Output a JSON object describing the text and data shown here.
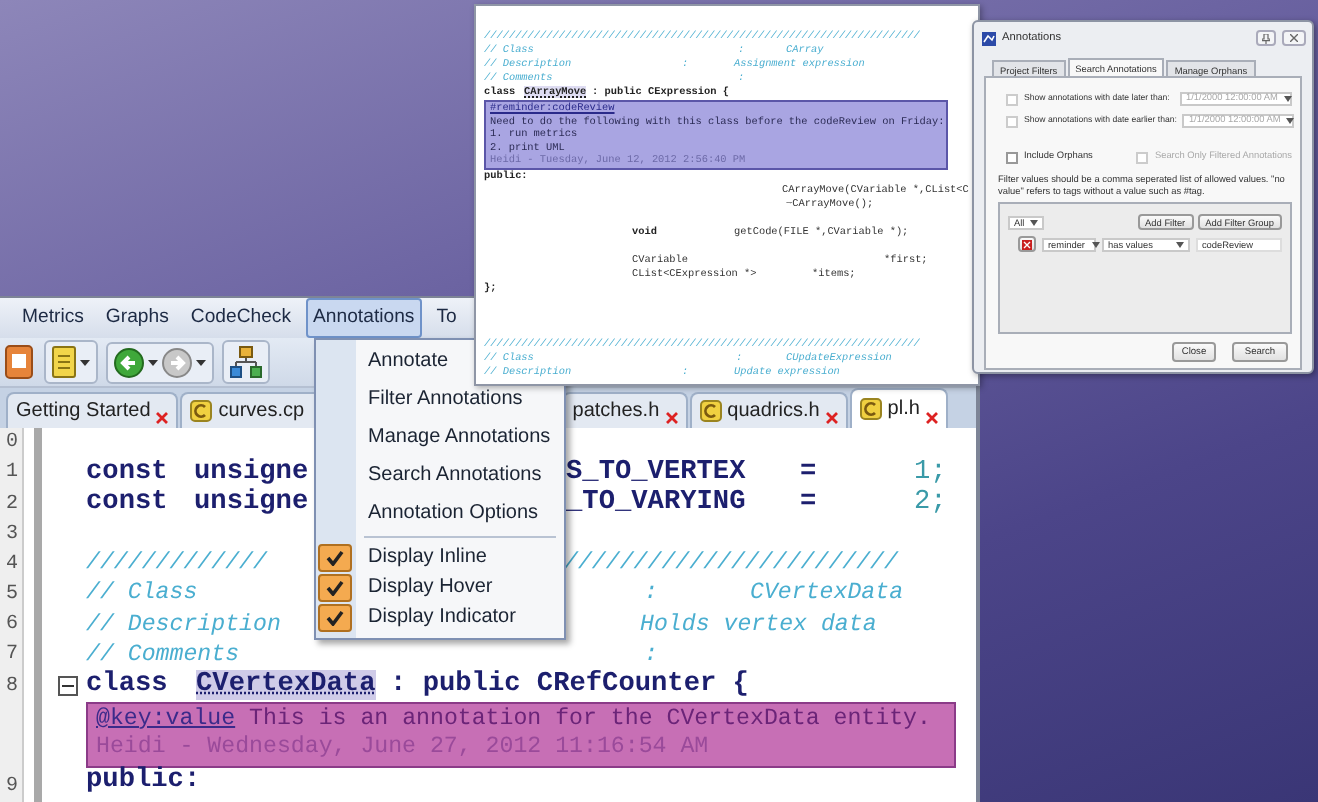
{
  "code_window": {
    "lines": [
      {
        "kind": "code",
        "segments": [
          {
            "text": "//////////////////////////////////////////////////////////////////////",
            "kind": "comment"
          }
        ]
      },
      {
        "kind": "code",
        "segments": [
          {
            "text": "// Class",
            "kind": "comment"
          },
          {
            "text": ":",
            "kind": "comment"
          },
          {
            "text": "CArray",
            "kind": "comment"
          }
        ]
      },
      {
        "kind": "code",
        "segments": [
          {
            "text": "// Description",
            "kind": "comment"
          },
          {
            "text": ":",
            "kind": "comment"
          },
          {
            "text": "Assignment expression",
            "kind": "comment"
          }
        ]
      },
      {
        "kind": "code",
        "segments": [
          {
            "text": "// Comments",
            "kind": "comment"
          },
          {
            "text": ":",
            "kind": "comment"
          }
        ]
      },
      {
        "kind": "code",
        "segments": [
          {
            "text": "class",
            "kind": "keyword"
          },
          {
            "text": "CArrayMove",
            "kind": "highlight"
          },
          {
            "text": ": public CExpression {",
            "kind": "keyword"
          }
        ]
      },
      {
        "kind": "annotation",
        "tag": "#reminder:codeReview",
        "body": [
          "Need to do the following with this class before the codeReview on Friday:",
          "1. run metrics",
          "2. print UML"
        ],
        "author": "Heidi - Tuesday, June 12, 2012 2:56:40 PM"
      },
      {
        "kind": "code",
        "segments": [
          {
            "text": "public:",
            "kind": "keyword"
          }
        ]
      },
      {
        "kind": "code",
        "segments": [
          {
            "text": "CArrayMove(CVariable *,CList<C",
            "kind": "plain"
          }
        ]
      },
      {
        "kind": "code",
        "segments": [
          {
            "text": "~CArrayMove();",
            "kind": "plain"
          }
        ]
      },
      {
        "kind": "blank"
      },
      {
        "kind": "code",
        "segments": [
          {
            "text": "void",
            "kind": "keyword"
          },
          {
            "text": "getCode(FILE *,CVariable *);",
            "kind": "plain"
          }
        ]
      },
      {
        "kind": "blank"
      },
      {
        "kind": "code",
        "segments": [
          {
            "text": "CVariable",
            "kind": "plain"
          },
          {
            "text": "*first;",
            "kind": "plain"
          }
        ]
      },
      {
        "kind": "code",
        "segments": [
          {
            "text": "CList<CExpression *>",
            "kind": "plain"
          },
          {
            "text": "*items;",
            "kind": "plain"
          }
        ]
      },
      {
        "kind": "code",
        "segments": [
          {
            "text": "};",
            "kind": "keyword"
          }
        ]
      },
      {
        "kind": "blank"
      },
      {
        "kind": "blank"
      },
      {
        "kind": "blank"
      },
      {
        "kind": "code",
        "segments": [
          {
            "text": "//////////////////////////////////////////////////////////////////////",
            "kind": "comment"
          }
        ]
      },
      {
        "kind": "code",
        "segments": [
          {
            "text": "// Class",
            "kind": "comment"
          },
          {
            "text": ":",
            "kind": "comment"
          },
          {
            "text": "CUpdateExpression",
            "kind": "comment"
          }
        ]
      },
      {
        "kind": "code",
        "segments": [
          {
            "text": "// Description",
            "kind": "comment"
          },
          {
            "text": ":",
            "kind": "comment"
          },
          {
            "text": "Update expression",
            "kind": "comment"
          }
        ]
      }
    ]
  },
  "annotations_dialog": {
    "title": "Annotations",
    "tabs": [
      {
        "label": "Project Filters",
        "selected": false
      },
      {
        "label": "Search Annotations",
        "selected": true
      },
      {
        "label": "Manage Orphans",
        "selected": false
      }
    ],
    "date_filters": [
      {
        "label": "Show annotations with date later than:",
        "checked": false,
        "value": "1/1/2000 12:00:00 AM",
        "disabled": true
      },
      {
        "label": "Show annotations with date earlier than:",
        "checked": false,
        "value": "1/1/2000 12:00:00 AM",
        "disabled": true
      }
    ],
    "include_orphans": {
      "label": "Include Orphans",
      "checked": false
    },
    "search_only_filtered": {
      "label": "Search Only Filtered Annotations",
      "checked": false,
      "disabled": true
    },
    "help_text": "Filter values should be a comma seperated list of allowed values. \"no value\" refers to tags without a value such as #tag.",
    "match": "All",
    "add_filter": "Add Filter",
    "add_filter_group": "Add Filter Group",
    "filters": [
      {
        "tag": "reminder",
        "condition": "has values",
        "value": "codeReview"
      }
    ],
    "buttons": [
      "Close",
      "Search"
    ]
  },
  "main_window": {
    "menubar": [
      {
        "label": "Metrics",
        "selected": false
      },
      {
        "label": "Graphs",
        "selected": false
      },
      {
        "label": "CodeCheck",
        "selected": false
      },
      {
        "label": "Annotations",
        "selected": true
      },
      {
        "label": "To",
        "selected": false
      }
    ],
    "tabs": [
      {
        "label": "Getting Started",
        "selected": false,
        "file_icon": false,
        "closable": true
      },
      {
        "label": "curves.cp",
        "selected": false,
        "file_icon": true,
        "closable": false
      },
      {
        "label": "patches.h",
        "selected": false,
        "file_icon": false,
        "closable": true
      },
      {
        "label": "quadrics.h",
        "selected": false,
        "file_icon": true,
        "closable": true
      },
      {
        "label": "pl.h",
        "selected": true,
        "file_icon": true,
        "closable": true
      }
    ],
    "lines": [
      {
        "kind": "code",
        "number": "0"
      },
      {
        "kind": "code",
        "number": "1",
        "segments": [
          {
            "text": "const",
            "kind": "keyword"
          },
          {
            "text": "unsigne",
            "kind": "keyword"
          },
          {
            "text": "S_TO_VERTEX",
            "kind": "keyword"
          },
          {
            "text": "=",
            "kind": "keyword"
          },
          {
            "text": "1;",
            "kind": "number"
          }
        ]
      },
      {
        "kind": "code",
        "number": "2",
        "segments": [
          {
            "text": "const",
            "kind": "keyword"
          },
          {
            "text": "unsigne",
            "kind": "keyword"
          },
          {
            "text": "_TO_VARYING",
            "kind": "keyword"
          },
          {
            "text": "=",
            "kind": "keyword"
          },
          {
            "text": "2;",
            "kind": "number"
          }
        ]
      },
      {
        "kind": "code",
        "number": "3"
      },
      {
        "kind": "code",
        "number": "4",
        "segments": [
          {
            "text": "/////////////",
            "kind": "comment"
          },
          {
            "text": "////////////////////////",
            "kind": "comment"
          }
        ]
      },
      {
        "kind": "code",
        "number": "5",
        "segments": [
          {
            "text": "// Class",
            "kind": "comment"
          },
          {
            "text": ":",
            "kind": "comment"
          },
          {
            "text": "CVertexData",
            "kind": "comment"
          }
        ]
      },
      {
        "kind": "code",
        "number": "6",
        "segments": [
          {
            "text": "// Description",
            "kind": "comment"
          },
          {
            "text": "Holds vertex data",
            "kind": "comment"
          }
        ]
      },
      {
        "kind": "code",
        "number": "7",
        "segments": [
          {
            "text": "// Comments",
            "kind": "comment"
          },
          {
            "text": ":",
            "kind": "comment"
          }
        ]
      },
      {
        "kind": "code",
        "number": "8",
        "folded": false,
        "segments": [
          {
            "text": "class",
            "kind": "keyword"
          },
          {
            "text": "CVertexData",
            "kind": "highlight"
          },
          {
            "text": ": public CRefCounter {",
            "kind": "keyword"
          }
        ]
      },
      {
        "kind": "annotation",
        "tag": "@key:value",
        "text": "This is an annotation for the CVertexData entity.",
        "author": "Heidi - Wednesday, June 27, 2012 11:16:54 AM"
      },
      {
        "kind": "code",
        "number": "9",
        "segments": [
          {
            "text": "public:",
            "kind": "keyword"
          }
        ]
      }
    ],
    "annotations_menu": [
      {
        "kind": "action",
        "label": "Annotate"
      },
      {
        "kind": "action",
        "label": "Filter Annotations"
      },
      {
        "kind": "action",
        "label": "Manage Annotations"
      },
      {
        "kind": "action",
        "label": "Search Annotations"
      },
      {
        "kind": "action",
        "label": "Annotation Options"
      },
      {
        "kind": "separator"
      },
      {
        "kind": "toggle",
        "label": "Display Inline",
        "checked": true
      },
      {
        "kind": "toggle",
        "label": "Display Hover",
        "checked": true
      },
      {
        "kind": "toggle",
        "label": "Display Indicator",
        "checked": true
      }
    ]
  }
}
